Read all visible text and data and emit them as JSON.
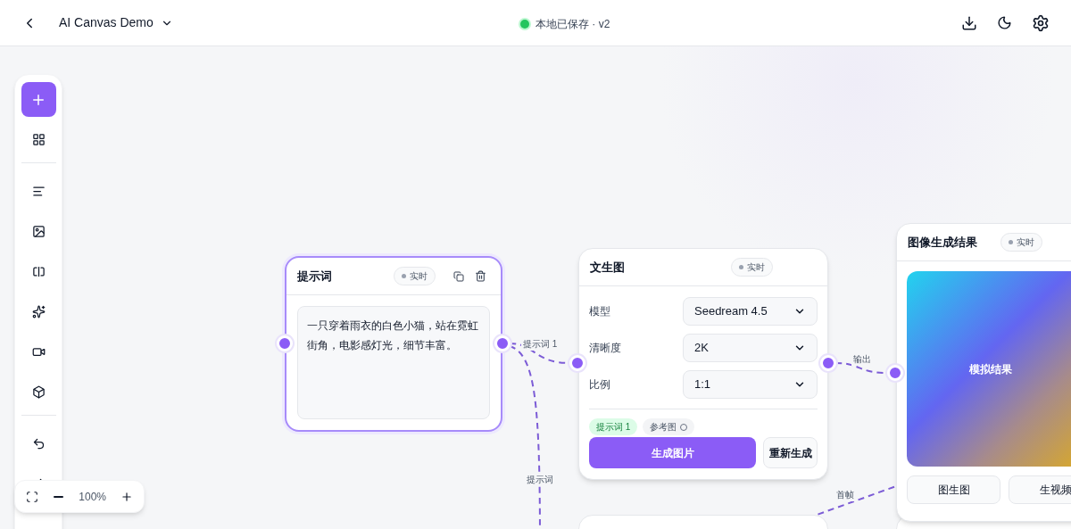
{
  "header": {
    "title": "AI Canvas Demo",
    "status": "本地已保存 · v2",
    "saved": true
  },
  "zoom_label": "100%",
  "nodes": [
    {
      "kind": "prompt",
      "title": "提示词",
      "badge": "实时",
      "selected": true,
      "text": "一只穿着雨衣的白色小猫，站在霓虹街角，电影感灯光，细节丰富。"
    },
    {
      "kind": "generator",
      "title": "文生图",
      "badge": "实时",
      "selected": false,
      "fields": [
        {
          "label": "模型",
          "value": "Seedream 4.5"
        },
        {
          "label": "清晰度",
          "value": "2K"
        },
        {
          "label": "比例",
          "value": "1:1"
        }
      ],
      "inputs": [
        {
          "label": "提示词 1",
          "connected": true
        },
        {
          "label": "参考图",
          "connected": false
        }
      ],
      "primary_action": "生成图片",
      "secondary_action": "重新生成"
    },
    {
      "kind": "result",
      "title": "图像生成结果",
      "badge": "实时",
      "selected": false,
      "preview_label": "模拟结果",
      "actions": [
        "图生图",
        "生视频"
      ]
    }
  ],
  "edges": [
    {
      "label": "提示词 1"
    },
    {
      "label": "提示词"
    },
    {
      "label": "输出"
    },
    {
      "label": "首帧"
    }
  ]
}
